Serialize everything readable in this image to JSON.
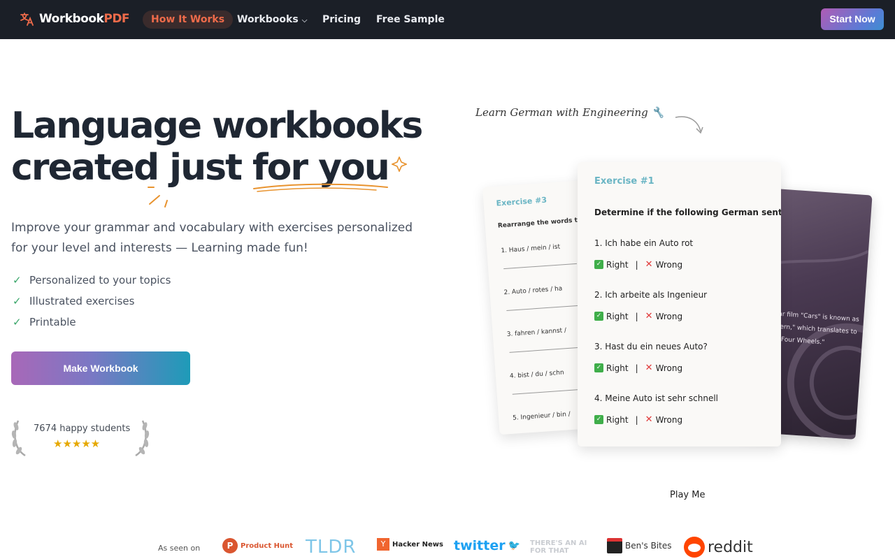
{
  "nav": {
    "logo_main": "Workbook",
    "logo_accent": "PDF",
    "links": [
      "How It Works",
      "Workbooks",
      "Pricing",
      "Free Sample"
    ],
    "cta": "Start Now"
  },
  "hero": {
    "title_line1": "Language workbooks",
    "title_line2": "created just for you",
    "subtitle": "Improve your grammar and vocabulary with exercises personalized for your level and interests — Learning made fun!",
    "features": [
      "Personalized to your topics",
      "Illustrated exercises",
      "Printable"
    ],
    "button": "Make Workbook",
    "students": "7674 happy students",
    "stars": "★★★★★"
  },
  "showcase": {
    "note": "Learn German with Engineering 🔧",
    "card3": {
      "title": "Exercise #3",
      "instruction": "Rearrange the words to fo",
      "rows": [
        "1.  Haus  /  mein  /  ist",
        "2.  Auto  /  rotes  /  ha",
        "3.  fahren  /  kannst  /",
        "4.  bist  /  du  /  schn",
        "5.  Ingenieur  /  bin  /"
      ]
    },
    "card1": {
      "title": "Exercise #1",
      "instruction": "Determine if the following German sentences a",
      "questions": [
        "1.   Ich habe ein Auto rot",
        "2.   Ich arbeite als Ingenieur",
        "3.   Hast du ein neues Auto?",
        "4.   Meine Auto ist sehr schnell"
      ],
      "right": "Right",
      "wrong": "Wrong"
    },
    "photo_text": "ixar film \"Cars\" is known as adern,\" which translates to on Four Wheels.\"",
    "play": "Play Me"
  },
  "seen_on": {
    "label": "As seen on",
    "brands": [
      "Product Hunt",
      "TLDR",
      "Hacker News",
      "twitter",
      "THERE'S AN AI FOR THAT",
      "Ben's Bites",
      "reddit"
    ]
  }
}
